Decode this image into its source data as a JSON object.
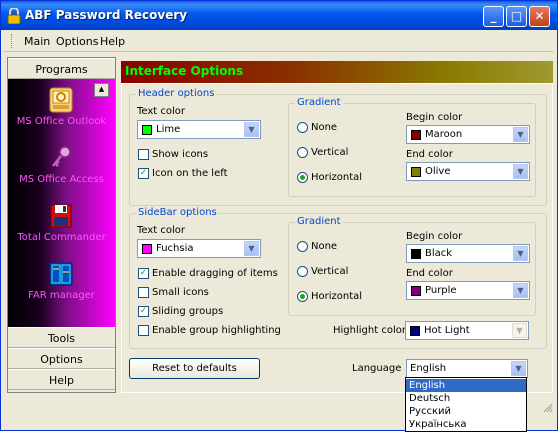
{
  "window": {
    "title": "ABF Password Recovery",
    "min_label": "_",
    "max_label": "□",
    "close_label": "✕"
  },
  "menu": [
    "Main",
    "Options",
    "Help"
  ],
  "sidebar": {
    "groups_top": [
      "Programs"
    ],
    "items": [
      {
        "label": "MS Office Outlook",
        "icon": "outlook-icon"
      },
      {
        "label": "MS Office Access",
        "icon": "access-key-icon"
      },
      {
        "label": "Total Commander",
        "icon": "floppy-icon"
      },
      {
        "label": "FAR manager",
        "icon": "far-icon"
      }
    ],
    "scroll_up_label": "▲",
    "groups_bottom": [
      "Tools",
      "Options",
      "Help"
    ],
    "colors": {
      "label": "#ff55ff",
      "panel_start": "#000000",
      "panel_end": "#ff00ff"
    }
  },
  "page": {
    "title": "Interface Options",
    "title_color": "#00ff00"
  },
  "header_options": {
    "legend": "Header options",
    "text_color_label": "Text color",
    "text_color": {
      "value": "Lime",
      "swatch": "#00ff00"
    },
    "show_icons": {
      "label": "Show icons",
      "checked": false
    },
    "icon_left": {
      "label": "Icon on the left",
      "checked": true
    },
    "gradient": {
      "legend": "Gradient",
      "options": [
        "None",
        "Vertical",
        "Horizontal"
      ],
      "selected": "Horizontal",
      "begin_label": "Begin color",
      "begin": {
        "value": "Maroon",
        "swatch": "#800000"
      },
      "end_label": "End color",
      "end": {
        "value": "Olive",
        "swatch": "#808000"
      }
    }
  },
  "sidebar_options": {
    "legend": "SideBar options",
    "text_color_label": "Text color",
    "text_color": {
      "value": "Fuchsia",
      "swatch": "#ff00ff"
    },
    "checks": [
      {
        "label": "Enable dragging of items",
        "checked": true
      },
      {
        "label": "Small icons",
        "checked": false
      },
      {
        "label": "Sliding groups",
        "checked": true
      },
      {
        "label": "Enable group highlighting",
        "checked": false
      }
    ],
    "gradient": {
      "legend": "Gradient",
      "options": [
        "None",
        "Vertical",
        "Horizontal"
      ],
      "selected": "Horizontal",
      "begin_label": "Begin color",
      "begin": {
        "value": "Black",
        "swatch": "#000000"
      },
      "end_label": "End color",
      "end": {
        "value": "Purple",
        "swatch": "#800080"
      }
    },
    "highlight_label": "Highlight color",
    "highlight": {
      "value": "Hot Light",
      "swatch": "#000080",
      "enabled": false
    }
  },
  "footer": {
    "reset_label": "Reset to defaults",
    "language_label": "Language",
    "language_value": "English",
    "language_options": [
      "English",
      "Deutsch",
      "Русский",
      "Українська"
    ],
    "language_selected_index": 0
  },
  "arrow_glyph": "▼",
  "check_glyph": "✓"
}
